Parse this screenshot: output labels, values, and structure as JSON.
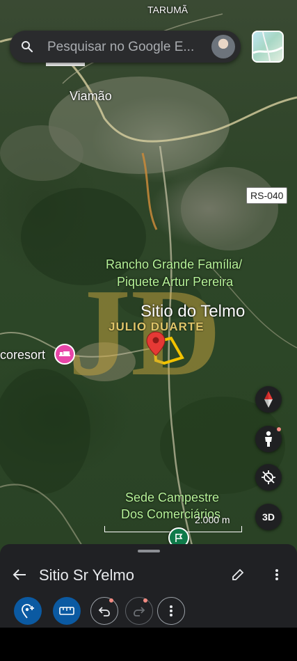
{
  "search": {
    "placeholder": "Pesquisar no Google E..."
  },
  "map": {
    "labels": {
      "top_partial": "TARUMÃ",
      "city": "Viamão",
      "road": "RS-040",
      "poi_1_line1": "Rancho Grande Família/",
      "poi_1_line2": "Piquete Artur Pereira",
      "place": "Sitio do Telmo",
      "hotel": "coresort",
      "poi_2_line1": "Sede Campestre",
      "poi_2_line2": "Dos Comerciários"
    },
    "watermark": {
      "monogram": "JD",
      "text": "JULIO DUARTE"
    },
    "scale": "2.000 m",
    "controls": {
      "three_d": "3D"
    }
  },
  "sheet": {
    "title": "Sitio Sr Yelmo"
  },
  "icons": {
    "search": "search-icon",
    "back": "arrow-back-icon",
    "edit": "pencil-icon",
    "more": "more-vert-icon",
    "pin": "map-pin-icon",
    "compass": "compass-icon",
    "pegman": "pegman-icon",
    "location": "location-off-icon"
  },
  "colors": {
    "accent_blue": "#0b5aa2",
    "pin_red": "#e53935",
    "label_green": "#b8f59a",
    "outline_yellow": "#f2c200"
  }
}
